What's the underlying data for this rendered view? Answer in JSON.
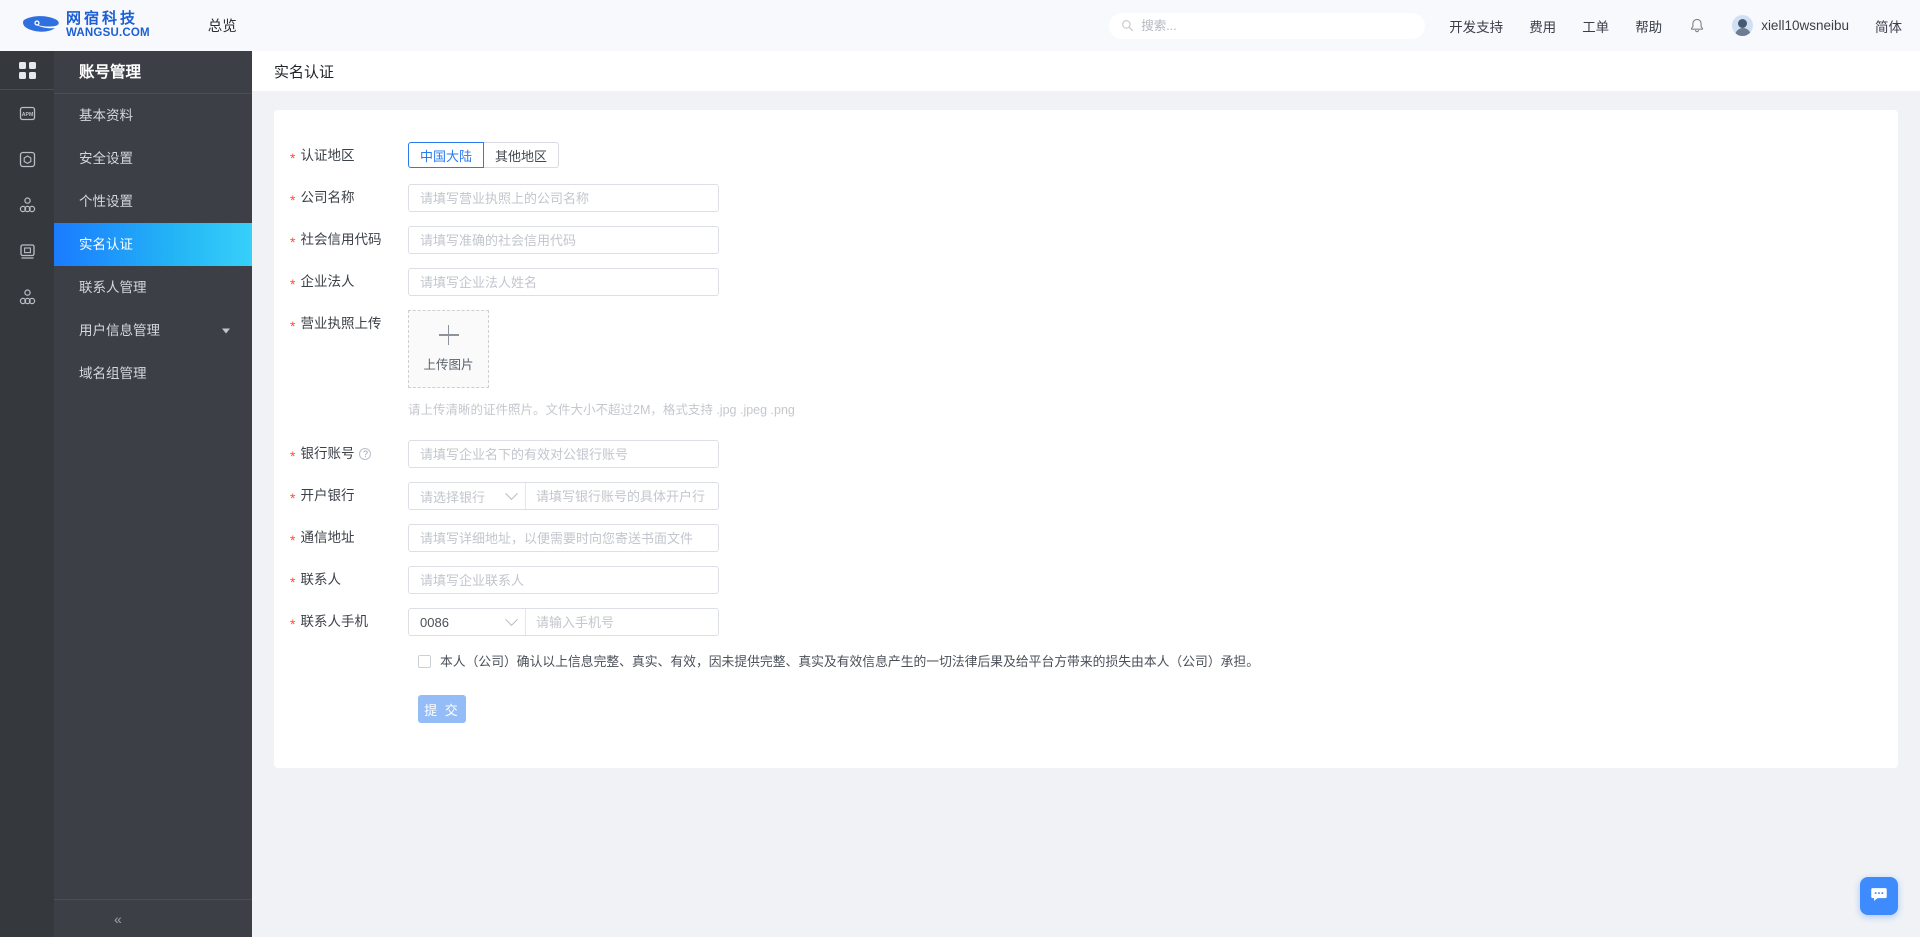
{
  "header": {
    "logo_cn": "网宿科技",
    "logo_en": "WANGSU.COM",
    "overview": "总览",
    "search_placeholder": "搜索...",
    "search_value": "",
    "links": [
      "开发支持",
      "费用",
      "工单",
      "帮助"
    ],
    "username": "xiell10wsneibu",
    "language": "简体"
  },
  "rail": {
    "items": [
      {
        "name": "apps-grid-icon"
      },
      {
        "name": "apm-icon"
      },
      {
        "name": "cube-icon"
      },
      {
        "name": "nodes-icon"
      },
      {
        "name": "monitor-icon"
      },
      {
        "name": "cluster-icon"
      }
    ]
  },
  "sidebar": {
    "title": "账号管理",
    "items": [
      {
        "label": "基本资料",
        "active": false,
        "caret": false
      },
      {
        "label": "安全设置",
        "active": false,
        "caret": false
      },
      {
        "label": "个性设置",
        "active": false,
        "caret": false
      },
      {
        "label": "实名认证",
        "active": true,
        "caret": false
      },
      {
        "label": "联系人管理",
        "active": false,
        "caret": false
      },
      {
        "label": "用户信息管理",
        "active": false,
        "caret": true
      },
      {
        "label": "域名组管理",
        "active": false,
        "caret": false
      }
    ],
    "collapse": "«"
  },
  "page": {
    "title": "实名认证"
  },
  "form": {
    "region": {
      "label": "认证地区",
      "options": [
        "中国大陆",
        "其他地区"
      ],
      "selected": "中国大陆"
    },
    "company_name": {
      "label": "公司名称",
      "placeholder": "请填写营业执照上的公司名称",
      "value": ""
    },
    "credit_code": {
      "label": "社会信用代码",
      "placeholder": "请填写准确的社会信用代码",
      "value": ""
    },
    "legal_person": {
      "label": "企业法人",
      "placeholder": "请填写企业法人姓名",
      "value": ""
    },
    "license_upload": {
      "label": "营业执照上传",
      "button_text": "上传图片",
      "hint": "请上传清晰的证件照片。文件大小不超过2M，格式支持 .jpg .jpeg .png"
    },
    "bank_account": {
      "label": "银行账号",
      "placeholder": "请填写企业名下的有效对公银行账号",
      "value": "",
      "has_help": true
    },
    "bank_branch": {
      "label": "开户银行",
      "select_placeholder": "请选择银行",
      "select_value": "",
      "placeholder": "请填写银行账号的具体开户行",
      "value": ""
    },
    "address": {
      "label": "通信地址",
      "placeholder": "请填写详细地址，以便需要时向您寄送书面文件",
      "value": ""
    },
    "contact": {
      "label": "联系人",
      "placeholder": "请填写企业联系人",
      "value": ""
    },
    "contact_phone": {
      "label": "联系人手机",
      "country_code": "0086",
      "placeholder": "请输入手机号",
      "value": ""
    },
    "agreement": {
      "checked": false,
      "text": "本人（公司）确认以上信息完整、真实、有效，因未提供完整、真实及有效信息产生的一切法律后果及给平台方带来的损失由本人（公司）承担。"
    },
    "submit_label": "提 交"
  },
  "colors": {
    "accent": "#2a7bf0",
    "active_nav_start": "#1a7bff",
    "active_nav_end": "#36d0fa",
    "required_star": "#f5503c",
    "submit_bg": "#94bdf7",
    "sidebar_bg": "#3c4046",
    "rail_bg": "#35393e",
    "page_bg": "#f0f2f5",
    "chat_fab": "#3d8bfd"
  }
}
